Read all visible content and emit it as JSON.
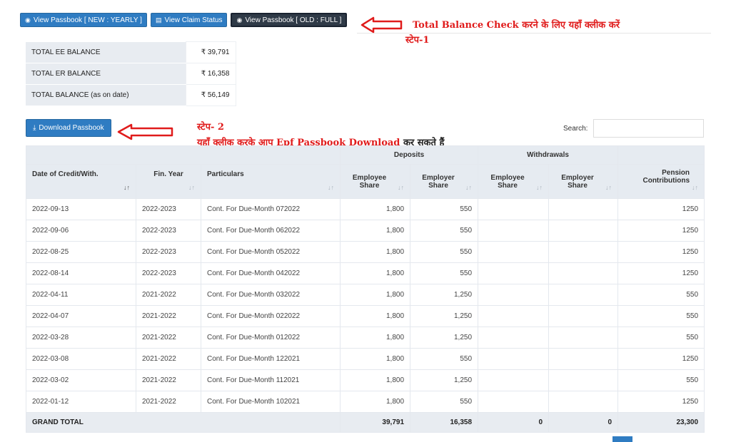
{
  "toolbar": {
    "btn_new_yearly": "View Passbook [ NEW : YEARLY ]",
    "btn_claim_status": "View Claim Status",
    "btn_old_full": "View Passbook [ OLD : FULL ]"
  },
  "annotations": {
    "step1_line1": "Total Balance Check करने के लिए यहाँ क्लीक करें",
    "step1_line2": "स्टेप-1",
    "step2_line1": "स्टेप- 2",
    "step2_line2a": "यहाँ क्लीक करके आप Epf Passbook Download",
    "step2_line2b": "कर सकते हैं",
    "color": "#e01b1b"
  },
  "balances": [
    {
      "label": "TOTAL EE BALANCE",
      "value": "₹ 39,791"
    },
    {
      "label": "TOTAL ER BALANCE",
      "value": "₹ 16,358"
    },
    {
      "label": "TOTAL BALANCE (as on date)",
      "value": "₹ 56,149"
    }
  ],
  "download_label": "Download Passbook",
  "search": {
    "label": "Search:",
    "value": ""
  },
  "table": {
    "group_deposits": "Deposits",
    "group_withdrawals": "Withdrawals",
    "col_date": "Date of Credit/With.",
    "col_fin_year": "Fin. Year",
    "col_particulars": "Particulars",
    "col_dep_emp_1": "Employee",
    "col_dep_emp_2": "Share",
    "col_dep_er_1": "Employer",
    "col_dep_er_2": "Share",
    "col_wd_emp_1": "Employee",
    "col_wd_emp_2": "Share",
    "col_wd_er_1": "Employer",
    "col_wd_er_2": "Share",
    "col_pension_1": "Pension",
    "col_pension_2": "Contributions",
    "rows": [
      {
        "date": "2022-09-13",
        "fy": "2022-2023",
        "particulars": "Cont. For Due-Month 072022",
        "ee": "1,800",
        "er": "550",
        "wee": "",
        "wer": "",
        "pension": "1250"
      },
      {
        "date": "2022-09-06",
        "fy": "2022-2023",
        "particulars": "Cont. For Due-Month 062022",
        "ee": "1,800",
        "er": "550",
        "wee": "",
        "wer": "",
        "pension": "1250"
      },
      {
        "date": "2022-08-25",
        "fy": "2022-2023",
        "particulars": "Cont. For Due-Month 052022",
        "ee": "1,800",
        "er": "550",
        "wee": "",
        "wer": "",
        "pension": "1250"
      },
      {
        "date": "2022-08-14",
        "fy": "2022-2023",
        "particulars": "Cont. For Due-Month 042022",
        "ee": "1,800",
        "er": "550",
        "wee": "",
        "wer": "",
        "pension": "1250"
      },
      {
        "date": "2022-04-11",
        "fy": "2021-2022",
        "particulars": "Cont. For Due-Month 032022",
        "ee": "1,800",
        "er": "1,250",
        "wee": "",
        "wer": "",
        "pension": "550"
      },
      {
        "date": "2022-04-07",
        "fy": "2021-2022",
        "particulars": "Cont. For Due-Month 022022",
        "ee": "1,800",
        "er": "1,250",
        "wee": "",
        "wer": "",
        "pension": "550"
      },
      {
        "date": "2022-03-28",
        "fy": "2021-2022",
        "particulars": "Cont. For Due-Month 012022",
        "ee": "1,800",
        "er": "1,250",
        "wee": "",
        "wer": "",
        "pension": "550"
      },
      {
        "date": "2022-03-08",
        "fy": "2021-2022",
        "particulars": "Cont. For Due-Month 122021",
        "ee": "1,800",
        "er": "550",
        "wee": "",
        "wer": "",
        "pension": "1250"
      },
      {
        "date": "2022-03-02",
        "fy": "2021-2022",
        "particulars": "Cont. For Due-Month 112021",
        "ee": "1,800",
        "er": "1,250",
        "wee": "",
        "wer": "",
        "pension": "550"
      },
      {
        "date": "2022-01-12",
        "fy": "2021-2022",
        "particulars": "Cont. For Due-Month 102021",
        "ee": "1,800",
        "er": "550",
        "wee": "",
        "wer": "",
        "pension": "1250"
      }
    ],
    "grand_total": {
      "label": "GRAND TOTAL",
      "ee": "39,791",
      "er": "16,358",
      "wee": "0",
      "wer": "0",
      "pension": "23,300"
    }
  },
  "icons": {
    "eye": "eye-icon",
    "list": "list-icon",
    "download": "download-icon",
    "sort": "sort-icon"
  },
  "colors": {
    "primary": "#2f7cc2",
    "dark_button": "#2f3a47",
    "header_bg": "#e6ebf1"
  }
}
